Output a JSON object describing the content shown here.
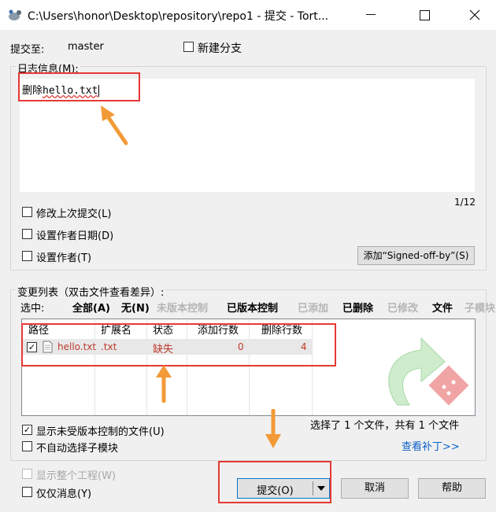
{
  "window": {
    "title": "C:\\Users\\honor\\Desktop\\repository\\repo1 - 提交 - Tort...",
    "minimize": "–",
    "maximize": "□",
    "close": "✕"
  },
  "commit_to": {
    "label": "提交至:",
    "branch": "master"
  },
  "new_branch": {
    "label": "新建分支",
    "checked": false
  },
  "message": {
    "group_label": "日志信息(M):",
    "text_plain": "删除",
    "text_squiggle": "hello.txt",
    "counter": "1/12"
  },
  "options": {
    "amend": "修改上次提交(L)",
    "set_author_date": "设置作者日期(D)",
    "set_author": "设置作者(T)",
    "signed_off_button": "添加“Signed-off-by”(S)"
  },
  "changes": {
    "group_label": "变更列表（双击文件查看差异）:",
    "select_label": "选中:",
    "filters": {
      "all": "全部(A)",
      "none": "无(N)",
      "unversioned": "未版本控制",
      "versioned": "已版本控制",
      "added": "已添加",
      "deleted": "已删除",
      "modified": "已修改",
      "files": "文件",
      "submodules": "子模块"
    },
    "columns": {
      "path": "路径",
      "ext": "扩展名",
      "status": "状态",
      "added_lines": "添加行数",
      "removed_lines": "删除行数"
    },
    "rows": [
      {
        "checked": true,
        "path": "hello.txt",
        "ext": ".txt",
        "status": "缺失",
        "added": "0",
        "removed": "4"
      }
    ],
    "summary": "选择了 1 个文件，共有 1 个文件",
    "view_patch": "查看补丁>>"
  },
  "bottom": {
    "show_unversioned": "显示未受版本控制的文件(U)",
    "no_autoselect_submodules": "不自动选择子模块",
    "show_whole_project": "显示整个工程(W)",
    "message_only": "仅仅消息(Y)",
    "commit_button": "提交(O)",
    "cancel_button": "取消",
    "help_button": "帮助"
  },
  "colors": {
    "annotation_red": "#e53935",
    "annotation_orange": "#f29a38",
    "missing_status": "#c0392b",
    "link_blue": "#0b62c9"
  }
}
